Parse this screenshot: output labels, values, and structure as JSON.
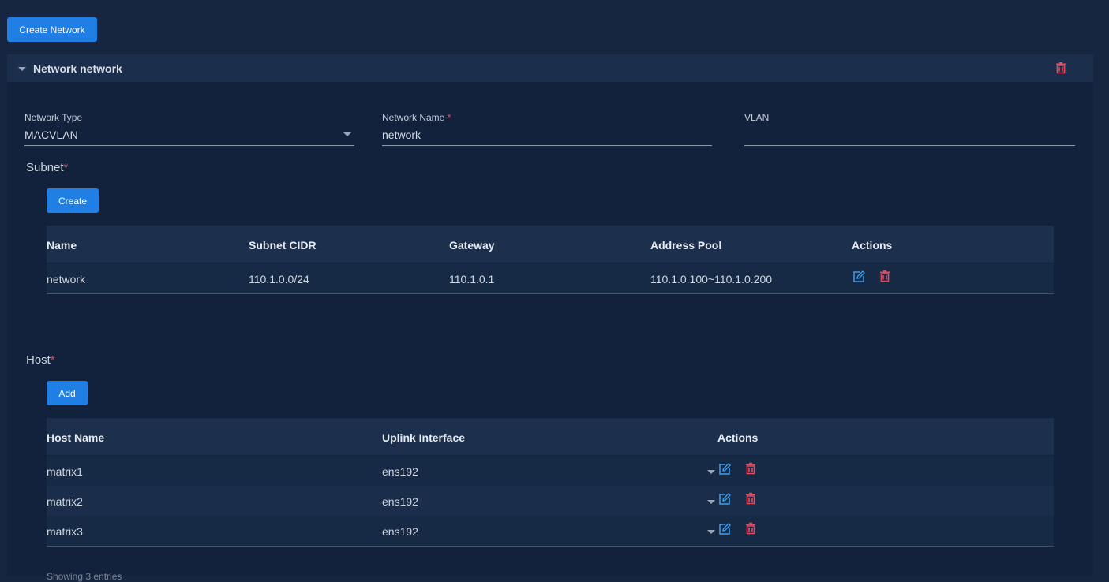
{
  "toolbar": {
    "create_network_label": "Create Network"
  },
  "network": {
    "title": "Network network",
    "fields": {
      "type_label": "Network Type",
      "type_value": "MACVLAN",
      "name_label": "Network Name",
      "name_value": "network",
      "vlan_label": "VLAN",
      "vlan_value": "",
      "required_mark": "*"
    }
  },
  "subnet": {
    "title": "Subnet",
    "create_label": "Create",
    "columns": [
      "Name",
      "Subnet CIDR",
      "Gateway",
      "Address Pool",
      "Actions"
    ],
    "rows": [
      {
        "name": "network",
        "cidr": "110.1.0.0/24",
        "gateway": "110.1.0.1",
        "pool": "110.1.0.100~110.1.0.200"
      }
    ]
  },
  "host": {
    "title": "Host",
    "add_label": "Add",
    "columns": [
      "Host Name",
      "Uplink Interface",
      "Actions"
    ],
    "rows": [
      {
        "name": "matrix1",
        "interface": "ens192"
      },
      {
        "name": "matrix2",
        "interface": "ens192"
      },
      {
        "name": "matrix3",
        "interface": "ens192"
      }
    ],
    "footer": "Showing 3 entries"
  },
  "colors": {
    "accent": "#1f7fe5",
    "danger": "#e8485d",
    "edit_icon": "#3fa0ef",
    "background": "#172640"
  },
  "icons": {
    "edit": "edit-icon",
    "delete": "trash-icon",
    "expand": "chevron-down-icon"
  }
}
